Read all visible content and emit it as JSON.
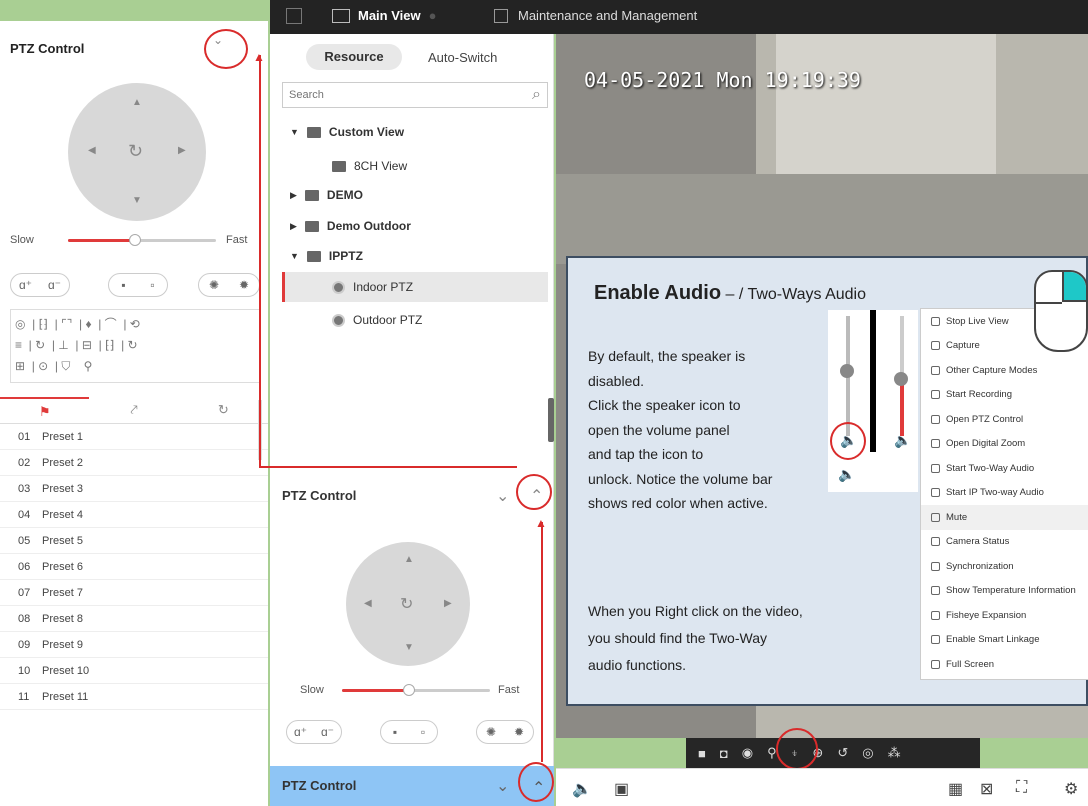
{
  "tabs": {
    "main_view": "Main View",
    "maintenance": "Maintenance and Management"
  },
  "left_panel": {
    "title": "PTZ Control",
    "speed_slow": "Slow",
    "speed_fast": "Fast",
    "speed_level": 0.45,
    "presets": [
      {
        "num": "01",
        "name": "Preset 1"
      },
      {
        "num": "02",
        "name": "Preset 2"
      },
      {
        "num": "03",
        "name": "Preset 3"
      },
      {
        "num": "04",
        "name": "Preset 4"
      },
      {
        "num": "05",
        "name": "Preset 5"
      },
      {
        "num": "06",
        "name": "Preset 6"
      },
      {
        "num": "07",
        "name": "Preset 7"
      },
      {
        "num": "08",
        "name": "Preset 8"
      },
      {
        "num": "09",
        "name": "Preset 9"
      },
      {
        "num": "10",
        "name": "Preset 10"
      },
      {
        "num": "11",
        "name": "Preset 11"
      }
    ]
  },
  "resource_panel": {
    "resource_tab": "Resource",
    "autoswitch_tab": "Auto-Switch",
    "search_placeholder": "Search",
    "tree": {
      "custom_view": "Custom View",
      "view_8ch": "8CH View",
      "demo": "DEMO",
      "demo_outdoor": "Demo Outdoor",
      "ipptz": "IPPTZ",
      "indoor_ptz": "Indoor PTZ",
      "outdoor_ptz": "Outdoor PTZ"
    },
    "ptz_title": "PTZ Control",
    "ptz_bottom_title": "PTZ Control",
    "speed_slow": "Slow",
    "speed_fast": "Fast"
  },
  "video": {
    "timestamp": "04-05-2021 Mon 19:19:39"
  },
  "annotation": {
    "heading_bold": "Enable Audio",
    "heading_rest": " – / Two-Ways Audio",
    "para1": [
      "By default, the speaker is",
      "disabled.",
      "Click the speaker icon to",
      "open the volume panel",
      "and tap the icon to",
      "unlock. Notice the volume bar",
      "shows red color when active."
    ],
    "para2": [
      "When you Right click on the video,",
      "you should find the Two-Way",
      "audio functions."
    ]
  },
  "context_menu": [
    "Stop Live View",
    "Capture",
    "Other Capture Modes",
    "Start Recording",
    "Open PTZ Control",
    "Open Digital Zoom",
    "Start Two-Way Audio",
    "Start IP Two-way Audio",
    "Mute",
    "Camera Status",
    "Synchronization",
    "Show Temperature Information",
    "Fisheye Expansion",
    "Enable Smart Linkage",
    "Full Screen"
  ],
  "colors": {
    "accent_red": "#d92b2b",
    "mouse_highlight": "#1ec8c8",
    "ptz_bottom_bg": "#8ec5f5"
  }
}
